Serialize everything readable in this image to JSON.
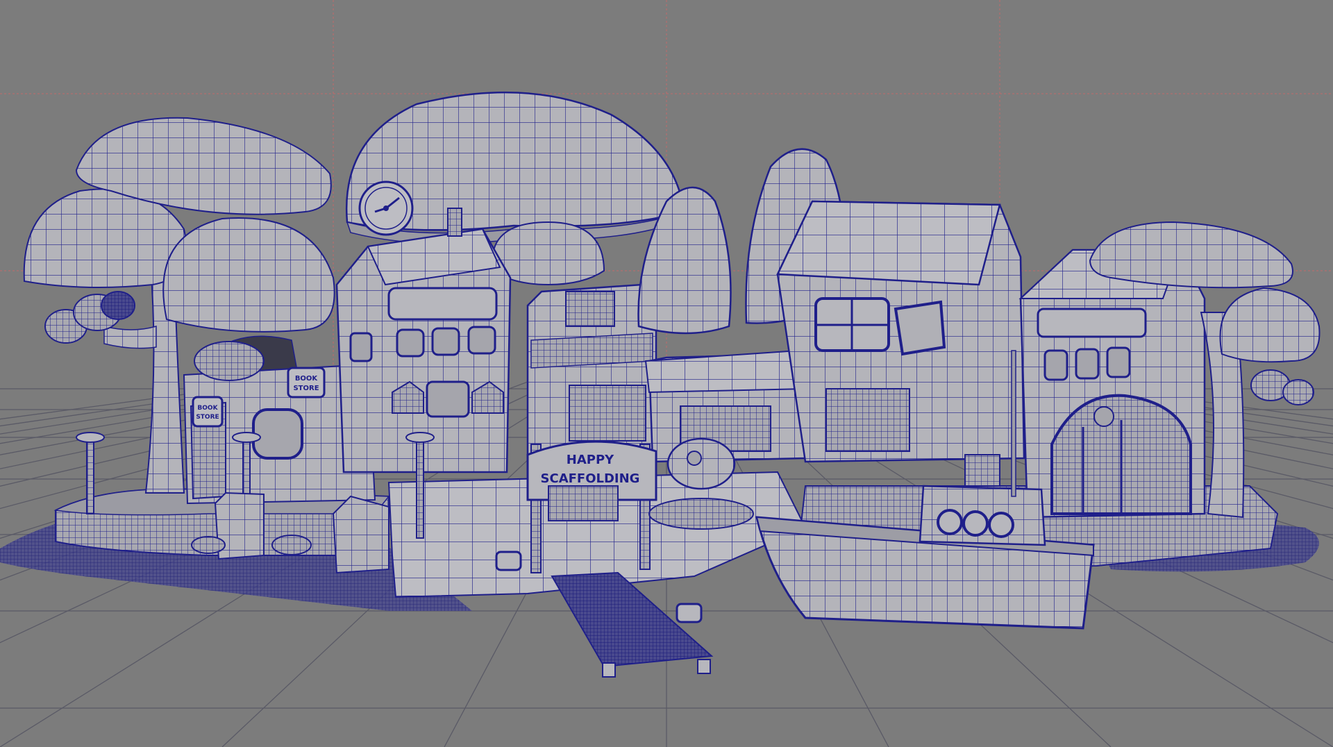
{
  "viewport": {
    "name": "3D modeling viewport - wireframe on shaded",
    "colors": {
      "background": "#7c7c7c",
      "ground_grid": "#5a5a66",
      "view_grid": "#c06a6a",
      "wireframe": "#1f1f8a",
      "surface_light": "#b9b9be",
      "surface_mid": "#a3a3aa",
      "surface_dark": "#8b8b93"
    }
  },
  "scene": {
    "signs": {
      "bookstore_top": [
        "BOOK",
        "STORE"
      ],
      "bookstore_side": [
        "BOOK",
        "STORE"
      ],
      "arch": [
        "HAPPY",
        "SCAFFOLDING"
      ]
    }
  }
}
